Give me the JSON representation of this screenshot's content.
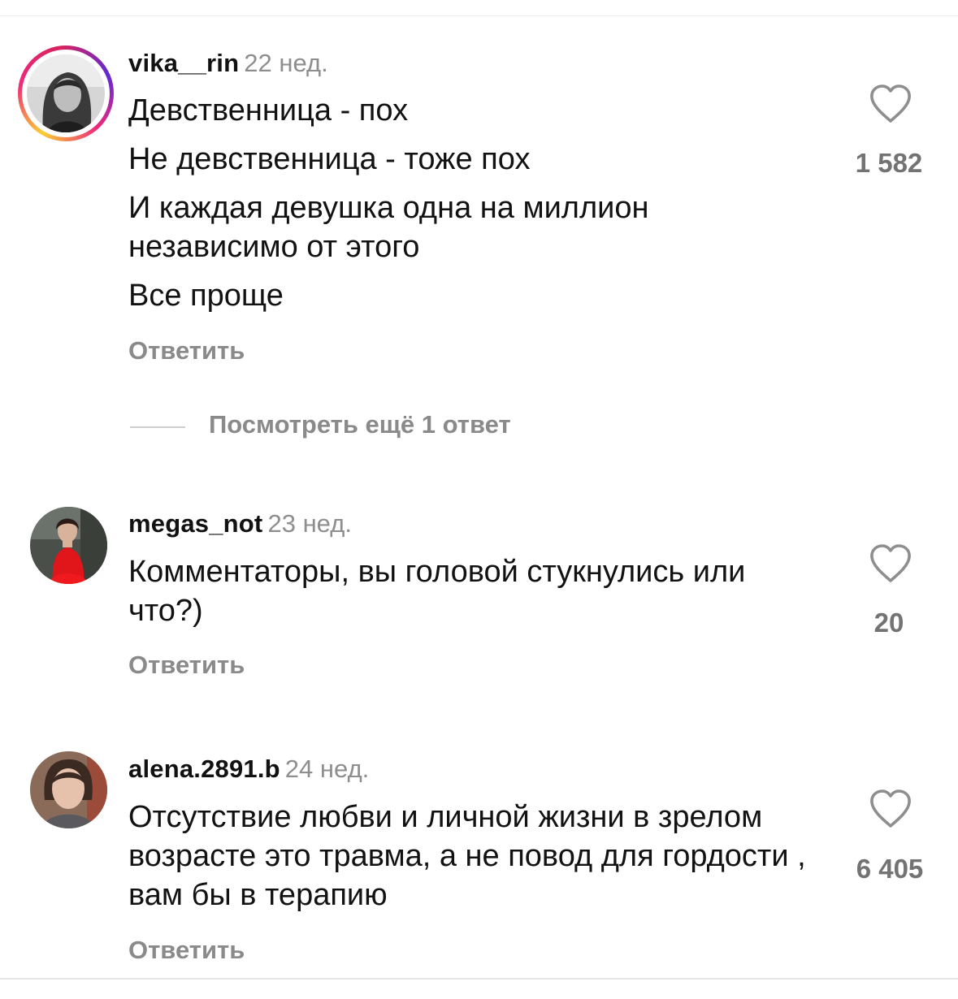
{
  "comments": [
    {
      "username": "vika__rin",
      "time": "22 нед.",
      "lines": [
        "Девственница - пох",
        "Не девственница - тоже пох",
        "И каждая девушка одна на миллион независимо от этого",
        "Все проще"
      ],
      "likes": "1 582",
      "reply_label": "Ответить",
      "has_story_ring": true
    },
    {
      "username": "megas_not",
      "time": "23 нед.",
      "lines": [
        "Комментаторы, вы головой стукнулись или что?)"
      ],
      "likes": "20",
      "reply_label": "Ответить",
      "has_story_ring": false
    },
    {
      "username": "alena.2891.b",
      "time": "24 нед.",
      "lines": [
        "Отсутствие любви и личной жизни в зрелом возрасте это травма, а не повод для гордости , вам бы в терапию"
      ],
      "likes": "6 405",
      "reply_label": "Ответить",
      "has_story_ring": false
    }
  ],
  "view_more_replies": "Посмотреть ещё 1 ответ",
  "icons": {
    "like": "heart-outline-icon"
  },
  "colors": {
    "username": "#111111",
    "muted": "#8e8e8e",
    "likes": "#737373"
  }
}
